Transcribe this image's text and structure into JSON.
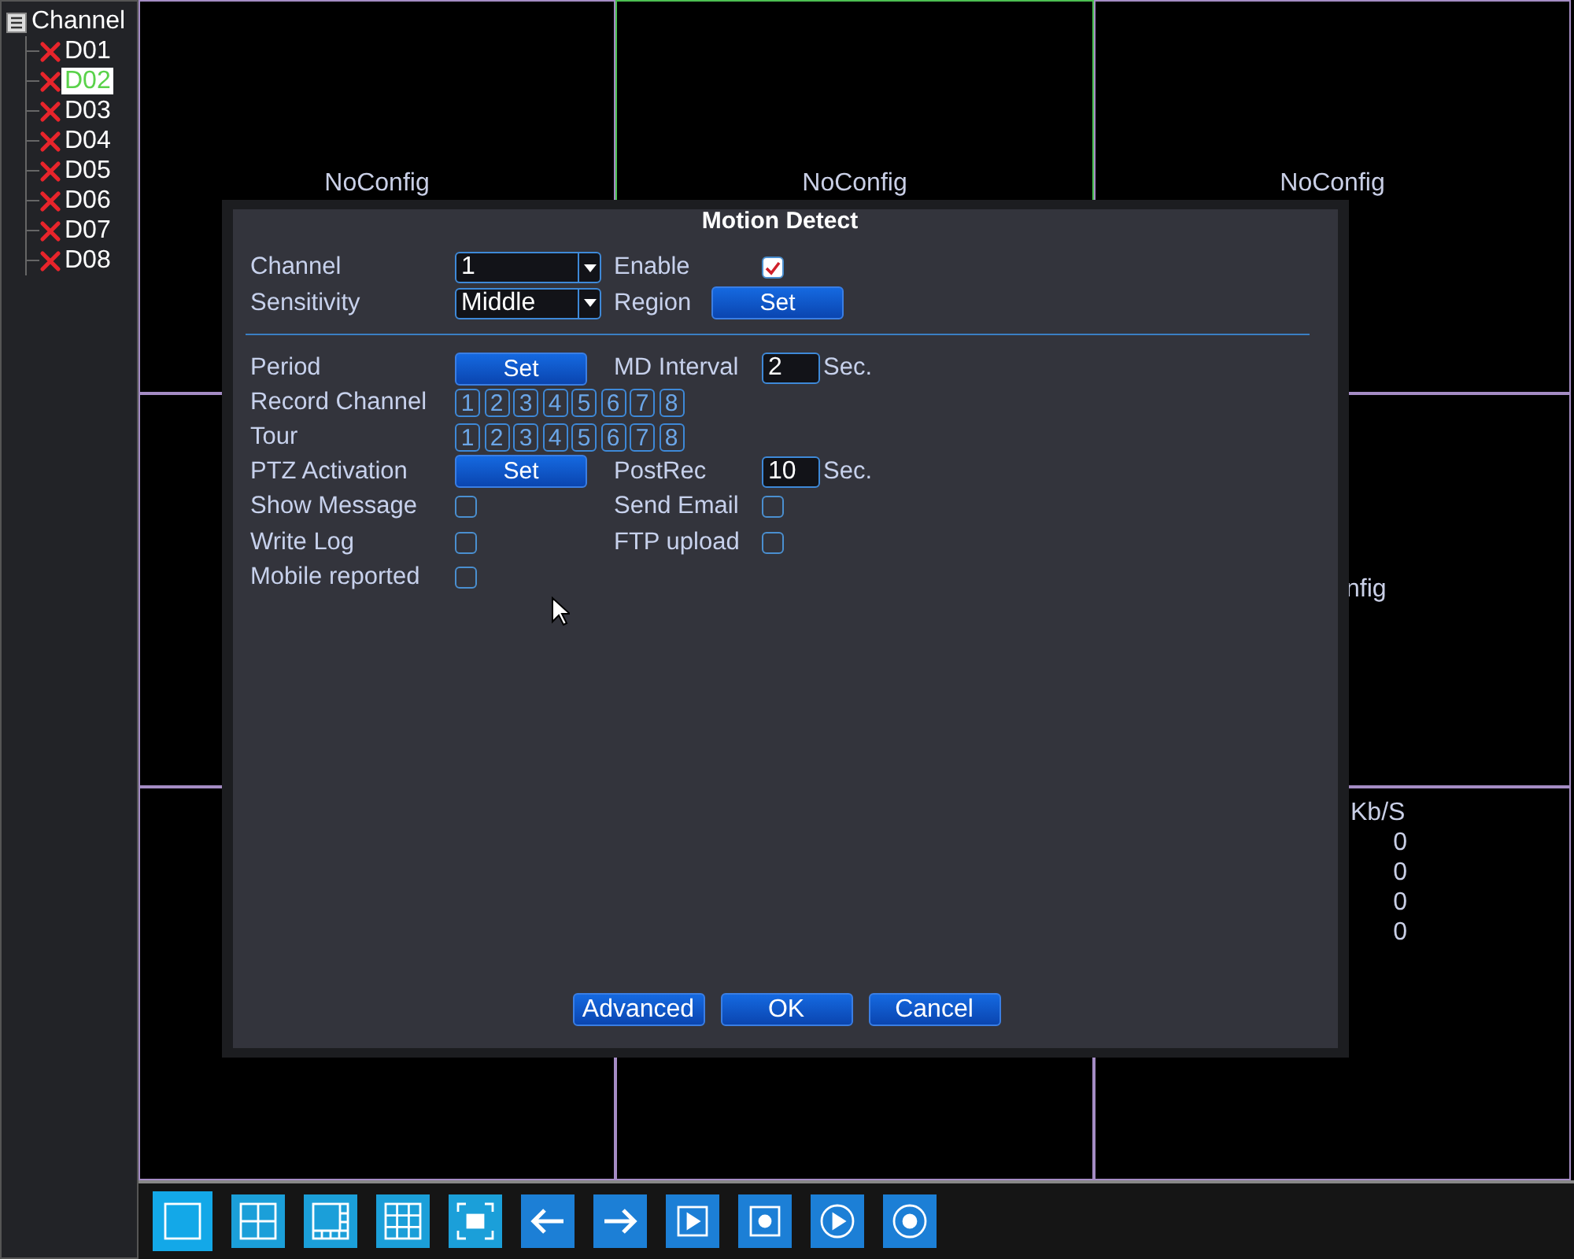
{
  "sidebar": {
    "title": "Channel",
    "items": [
      {
        "label": "D01",
        "selected": false
      },
      {
        "label": "D02",
        "selected": true
      },
      {
        "label": "D03",
        "selected": false
      },
      {
        "label": "D04",
        "selected": false
      },
      {
        "label": "D05",
        "selected": false
      },
      {
        "label": "D06",
        "selected": false
      },
      {
        "label": "D07",
        "selected": false
      },
      {
        "label": "D08",
        "selected": false
      }
    ]
  },
  "video_grid": {
    "cells": [
      {
        "kind": "label",
        "selected": false,
        "text": "NoConfig"
      },
      {
        "kind": "label",
        "selected": true,
        "text": "NoConfig"
      },
      {
        "kind": "label",
        "selected": false,
        "text": "NoConfig"
      },
      {
        "kind": "empty",
        "selected": false
      },
      {
        "kind": "empty"
      },
      {
        "kind": "partial",
        "selected": false,
        "text": "nfig"
      },
      {
        "kind": "empty",
        "selected": false
      },
      {
        "kind": "empty",
        "selected": false
      },
      {
        "kind": "bitrate",
        "selected": false,
        "header": "Kb/S",
        "values": [
          "0",
          "0",
          "0",
          "0"
        ]
      }
    ]
  },
  "dialog": {
    "title": "Motion Detect",
    "sections": [
      [
        [
          {
            "label": "Channel",
            "kind": "select",
            "value": "1"
          },
          {
            "label": "Enable",
            "kind": "checkbox",
            "checked": true
          }
        ],
        [
          {
            "label": "Sensitivity",
            "kind": "select",
            "value": "Middle"
          },
          {
            "label": "Region",
            "kind": "button",
            "value": "Set"
          }
        ]
      ],
      [
        [
          {
            "label": "Period",
            "kind": "button",
            "value": "Set"
          },
          {
            "label": "MD Interval",
            "kind": "input",
            "value": "2",
            "unit": "Sec."
          }
        ],
        [
          {
            "label": "Record Channel",
            "kind": "numbers",
            "values": [
              "1",
              "2",
              "3",
              "4",
              "5",
              "6",
              "7",
              "8"
            ]
          }
        ],
        [
          {
            "label": "Tour",
            "kind": "numbers",
            "values": [
              "1",
              "2",
              "3",
              "4",
              "5",
              "6",
              "7",
              "8"
            ]
          }
        ],
        [
          {
            "label": "PTZ Activation",
            "kind": "button",
            "value": "Set"
          },
          {
            "label": "PostRec",
            "kind": "input",
            "value": "10",
            "unit": "Sec."
          }
        ],
        [
          {
            "label": "Show Message",
            "kind": "checkbox",
            "checked": false
          },
          {
            "label": "Send Email",
            "kind": "checkbox",
            "checked": false
          }
        ],
        [
          {
            "label": "Write Log",
            "kind": "checkbox",
            "checked": false
          },
          {
            "label": "FTP upload",
            "kind": "checkbox",
            "checked": false
          }
        ],
        [
          {
            "label": "Mobile reported",
            "kind": "checkbox",
            "checked": false
          }
        ]
      ]
    ],
    "buttons": [
      "Advanced",
      "OK",
      "Cancel"
    ]
  },
  "toolbar": [
    {
      "kind": "single",
      "selected": true
    },
    {
      "kind": "quad",
      "selected": false
    },
    {
      "kind": "split",
      "selected": false
    },
    {
      "kind": "nine",
      "selected": false
    },
    {
      "kind": "fullscreen",
      "selected": false
    },
    {
      "kind": "prev",
      "selected": false
    },
    {
      "kind": "next",
      "selected": false
    },
    {
      "kind": "play",
      "selected": false
    },
    {
      "kind": "record",
      "selected": false
    },
    {
      "kind": "playback",
      "selected": false
    },
    {
      "kind": "stop",
      "selected": false
    }
  ]
}
